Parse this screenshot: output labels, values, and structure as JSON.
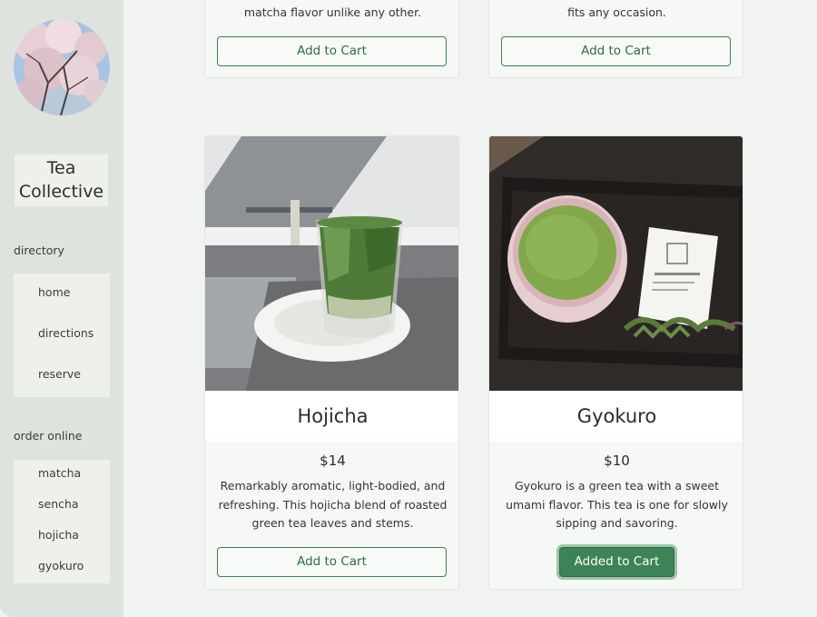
{
  "sidebar": {
    "brand": "Tea Collective",
    "directory_label": "directory",
    "directory_items": [
      {
        "label": "home"
      },
      {
        "label": "directions"
      },
      {
        "label": "reserve"
      }
    ],
    "order_label": "order online",
    "order_items": [
      {
        "label": "matcha"
      },
      {
        "label": "sencha"
      },
      {
        "label": "hojicha"
      },
      {
        "label": "gyokuro"
      }
    ]
  },
  "products": [
    {
      "title": "",
      "price": "",
      "desc_tail": "matcha flavor unlike any other.",
      "button": "Add to Cart",
      "added": false
    },
    {
      "title": "",
      "price": "",
      "desc_tail": "fits any occasion.",
      "button": "Add to Cart",
      "added": false
    },
    {
      "title": "Hojicha",
      "price": "$14",
      "desc_lines": [
        "Remarkably aromatic, light-bodied, and",
        "refreshing. This hojicha blend of roasted",
        "green tea leaves and stems."
      ],
      "button": "Add to Cart",
      "added": false
    },
    {
      "title": "Gyokuro",
      "price": "$10",
      "desc_lines": [
        "Gyokuro is a green tea with a sweet",
        "umami flavor. This tea is one for slowly",
        "sipping and savoring."
      ],
      "button": "Added to Cart",
      "added": true
    }
  ],
  "colors": {
    "accent": "#3e8357",
    "accent_text": "#2f6b45",
    "sidebar_bg": "#dfe3de",
    "page_bg": "#f1f3f0"
  }
}
